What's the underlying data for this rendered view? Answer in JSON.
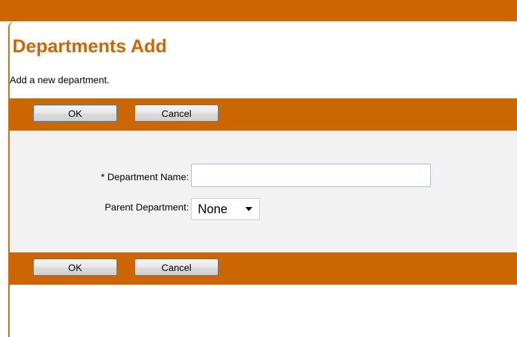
{
  "page": {
    "title": "Departments Add",
    "subtitle": "Add a new department."
  },
  "toolbar_top": {
    "ok_label": "OK",
    "cancel_label": "Cancel"
  },
  "toolbar_bottom": {
    "ok_label": "OK",
    "cancel_label": "Cancel"
  },
  "form": {
    "department_name_label": "* Department Name:",
    "department_name_value": "",
    "parent_department_label": "Parent Department:",
    "parent_department_selected": "None"
  },
  "colors": {
    "accent": "#cc6600",
    "panel_background": "#f2f2f2",
    "title_color": "#cc6600"
  }
}
